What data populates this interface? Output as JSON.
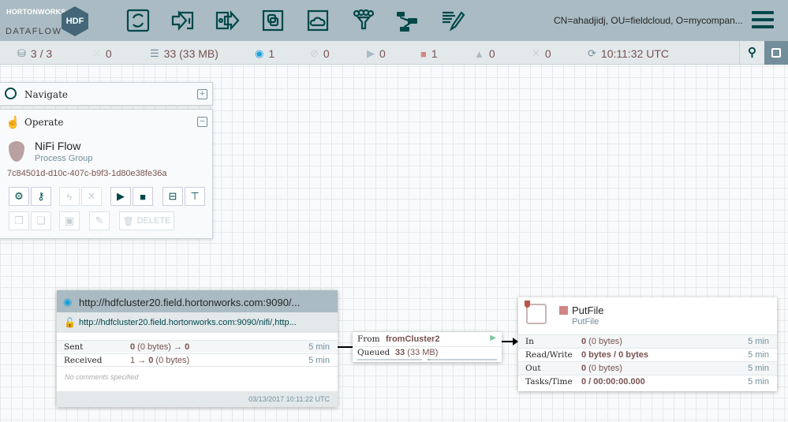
{
  "header": {
    "logo_top": "HORTONWORKS",
    "logo_bottom": "DATAFLOW",
    "logo_badge": "HDF",
    "user": "CN=ahadjidj, OU=fieldcloud, O=mycompan...",
    "toolbar": [
      "processor-icon",
      "input-port-icon",
      "output-port-icon",
      "process-group-icon",
      "remote-process-group-icon",
      "funnel-icon",
      "template-icon",
      "label-icon"
    ]
  },
  "status": {
    "nodes": "3 / 3",
    "threads": "0",
    "queued": "33 (33 MB)",
    "transmitting": "1",
    "not_transmitting": "0",
    "running": "0",
    "stopped": "1",
    "invalid": "0",
    "disabled": "0",
    "refreshed": "10:11:32 UTC"
  },
  "navigate": {
    "title": "Navigate"
  },
  "operate": {
    "title": "Operate",
    "name": "NiFi Flow",
    "type": "Process Group",
    "id": "7c84501d-d10c-407c-b9f3-1d80e38fe36a",
    "delete_label": "DELETE"
  },
  "rpg": {
    "title": "http://hdfcluster20.field.hortonworks.com:9090/...",
    "uri": "http://hdfcluster20.field.hortonworks.com:9090/nifi/,http...",
    "sent_label": "Sent",
    "sent_count": "0",
    "sent_rest": " (0 bytes) → ",
    "sent_out": "0",
    "sent_time": "5 min",
    "recv_label": "Received",
    "recv_in": "1 → ",
    "recv_count": "0",
    "recv_rest": " (0 bytes)",
    "recv_time": "5 min",
    "comments": "No comments specified",
    "timestamp": "03/13/2017 10:11:22 UTC"
  },
  "connection": {
    "from_label": "From",
    "from": "fromCluster2",
    "queued_label": "Queued",
    "queued_count": "33",
    "queued_size": " (33 MB)"
  },
  "processor": {
    "name": "PutFile",
    "type": "PutFile",
    "status_color": "#d18686",
    "rows": [
      {
        "label": "In",
        "count": "0",
        "rest": " (0 bytes)",
        "time": "5 min"
      },
      {
        "label": "Read/Write",
        "count": "0 bytes / 0 bytes",
        "rest": "",
        "time": "5 min"
      },
      {
        "label": "Out",
        "count": "0",
        "rest": " (0 bytes)",
        "time": "5 min"
      },
      {
        "label": "Tasks/Time",
        "count": "0 / 00:00:00.000",
        "rest": "",
        "time": "5 min"
      }
    ]
  }
}
